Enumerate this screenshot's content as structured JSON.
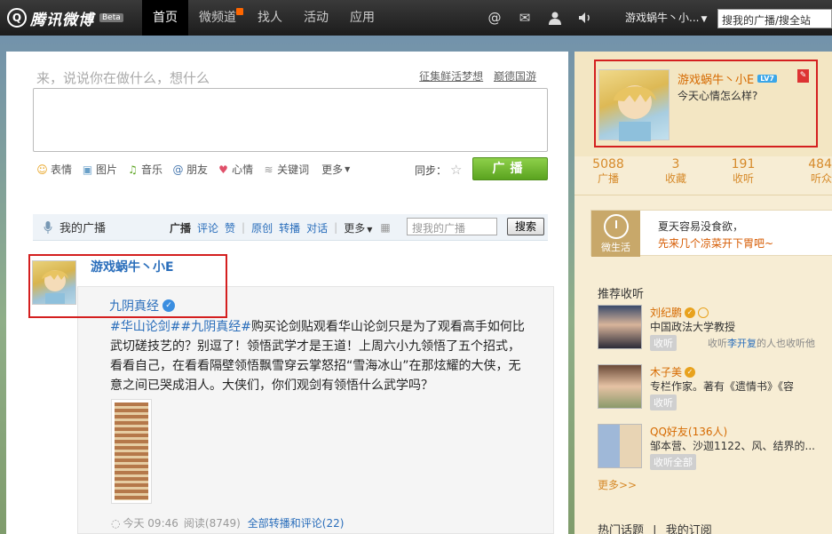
{
  "topbar": {
    "logo_text": "腾讯微博",
    "beta": "Beta",
    "nav": [
      "首页",
      "微频道",
      "找人",
      "活动",
      "应用"
    ],
    "user": "游戏蜗牛丶小...",
    "search": "搜我的广播/搜全站"
  },
  "compose": {
    "prompt": "来，说说你在做什么，想什么",
    "link1": "征集鲜活梦想",
    "link2": "巅德国游",
    "tools": [
      "表情",
      "图片",
      "音乐",
      "朋友",
      "心情",
      "关键词"
    ],
    "more": "更多",
    "sync": "同步：",
    "post": "广播"
  },
  "feed": {
    "title": "我的广播",
    "filters": [
      "广播",
      "评论",
      "赞",
      "原创",
      "转播",
      "对话",
      "更多"
    ],
    "search_placeholder": "搜我的广播",
    "search_button": "搜索"
  },
  "post": {
    "author": "游戏蜗牛丶小E",
    "quote_author": "九阴真经",
    "topic1": "#华山论剑#",
    "topic2": "#九阴真经#",
    "text": "购买论剑贴观看华山论剑只是为了观看高手如何比武切磋技艺的？别逗了！领悟武学才是王道！上周六小九领悟了五个招式，看看自己，在看看隔壁领悟飘雪穿云掌怒招“雪海冰山”在那炫耀的大侠，无意之间已哭成泪人。大侠们，你们观剑有领悟什么武学吗？",
    "time": "今天 09:46",
    "reads": "阅读(8749)",
    "all_link": "全部转播和评论(22)"
  },
  "profile": {
    "name": "游戏蜗牛丶小E",
    "level": "LV7",
    "mood": "今天心情怎么样?",
    "stats": [
      {
        "num": "5088",
        "label": "广播"
      },
      {
        "num": "3",
        "label": "收藏"
      },
      {
        "num": "191",
        "label": "收听"
      },
      {
        "num": "484",
        "label": "听众"
      }
    ]
  },
  "life": {
    "label": "微生活",
    "line1": "夏天容易没食欲，",
    "line2": "先来几个凉菜开下胃吧~"
  },
  "recommend": {
    "title": "推荐收听",
    "items": [
      {
        "name": "刘纪鹏",
        "desc": "中国政法大学教授",
        "btn": "收听",
        "extra_hl": "李开复",
        "extra_pre": "收听",
        "extra_post": "的人也收听他"
      },
      {
        "name": "木子美",
        "desc": "专栏作家。著有《遗情书》《容",
        "btn": "收听"
      },
      {
        "name": "QQ好友(136人)",
        "desc": "邹本营、沙迦1122、风、结界的...",
        "btn": "收听全部"
      }
    ],
    "more": "更多>>"
  },
  "hot": {
    "a": "热门话题",
    "sep": "|",
    "b": "我的订阅"
  },
  "colors": {
    "link": "#2a6ebb",
    "accent": "#d66a00",
    "post_green": "#5aa31f",
    "highlight_box": "#d41f1f"
  }
}
